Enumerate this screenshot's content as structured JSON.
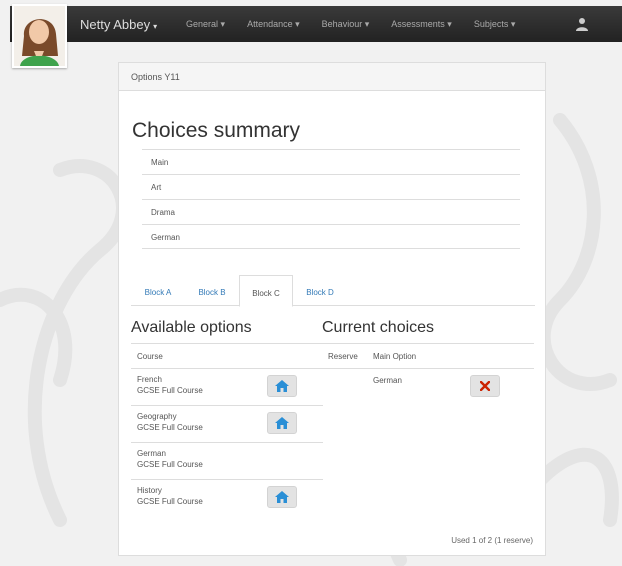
{
  "navbar": {
    "brand": "Netty Abbey",
    "menu": [
      {
        "label": "General"
      },
      {
        "label": "Attendance"
      },
      {
        "label": "Behaviour"
      },
      {
        "label": "Assessments"
      },
      {
        "label": "Subjects"
      }
    ],
    "caret": "▾"
  },
  "panel": {
    "heading": "Options Y11",
    "summary_title": "Choices summary",
    "summary_items": [
      "Main",
      "Art",
      "Drama",
      "German"
    ],
    "tabs": [
      {
        "label": "Block A"
      },
      {
        "label": "Block B"
      },
      {
        "label": "Block C"
      },
      {
        "label": "Block D"
      }
    ],
    "active_tab": "Block C",
    "available": {
      "title": "Available options",
      "header": "Course",
      "rows": [
        {
          "name": "French",
          "type": "GCSE Full Course"
        },
        {
          "name": "Geography",
          "type": "GCSE Full Course"
        },
        {
          "name": "German",
          "type": "GCSE Full Course"
        },
        {
          "name": "History",
          "type": "GCSE Full Course"
        }
      ]
    },
    "current": {
      "title": "Current choices",
      "headers": [
        "Reserve",
        "Main Option"
      ],
      "rows": [
        {
          "main": "German"
        }
      ]
    },
    "used_text": "Used 1 of 2 (1 reserve)"
  },
  "colors": {
    "navbar": "#2b2b2b",
    "link": "#337ab7",
    "add_icon": "#2a8fd6",
    "remove_icon": "#cc2200"
  }
}
